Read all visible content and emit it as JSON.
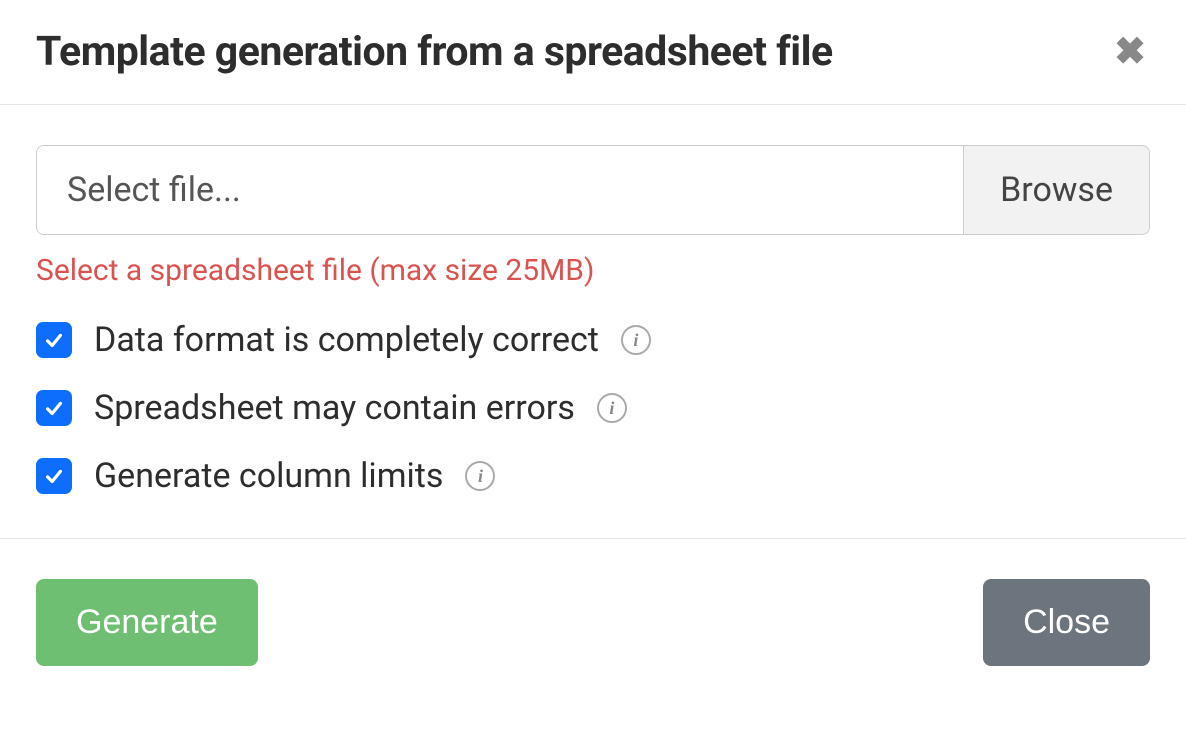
{
  "header": {
    "title": "Template generation from a spreadsheet file"
  },
  "file": {
    "placeholder": "Select file...",
    "browse_label": "Browse",
    "validation": "Select a spreadsheet file (max size 25MB)"
  },
  "options": [
    {
      "label": "Data format is completely correct",
      "checked": true
    },
    {
      "label": "Spreadsheet may contain errors",
      "checked": true
    },
    {
      "label": "Generate column limits",
      "checked": true
    }
  ],
  "footer": {
    "generate_label": "Generate",
    "close_label": "Close"
  },
  "info_glyph": "i"
}
